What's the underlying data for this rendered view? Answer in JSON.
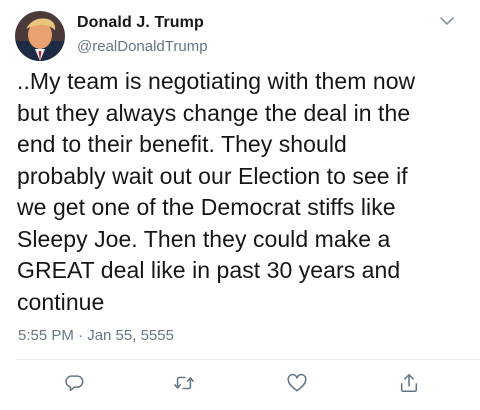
{
  "tweet": {
    "display_name": "Donald J. Trump",
    "handle": "@realDonaldTrump",
    "text": "..My team is negotiating with them now\nbut they always change the deal in the\nend to their benefit. They should\nprobably wait out our Election to see if\nwe get one of the Democrat stiffs like\nSleepy Joe. Then they could make a\nGREAT deal like in past 30 years and\ncontinue",
    "timestamp": "5:55 PM · Jan 55, 5555"
  },
  "icons": {
    "avatar": "avatar-photo",
    "menu": "chevron-down-icon",
    "reply": "reply-icon",
    "retweet": "retweet-icon",
    "like": "heart-icon",
    "share": "share-icon"
  },
  "colors": {
    "text": "#14171a",
    "secondary": "#657786",
    "icon": "#657786",
    "divider": "#e6ecf0"
  }
}
